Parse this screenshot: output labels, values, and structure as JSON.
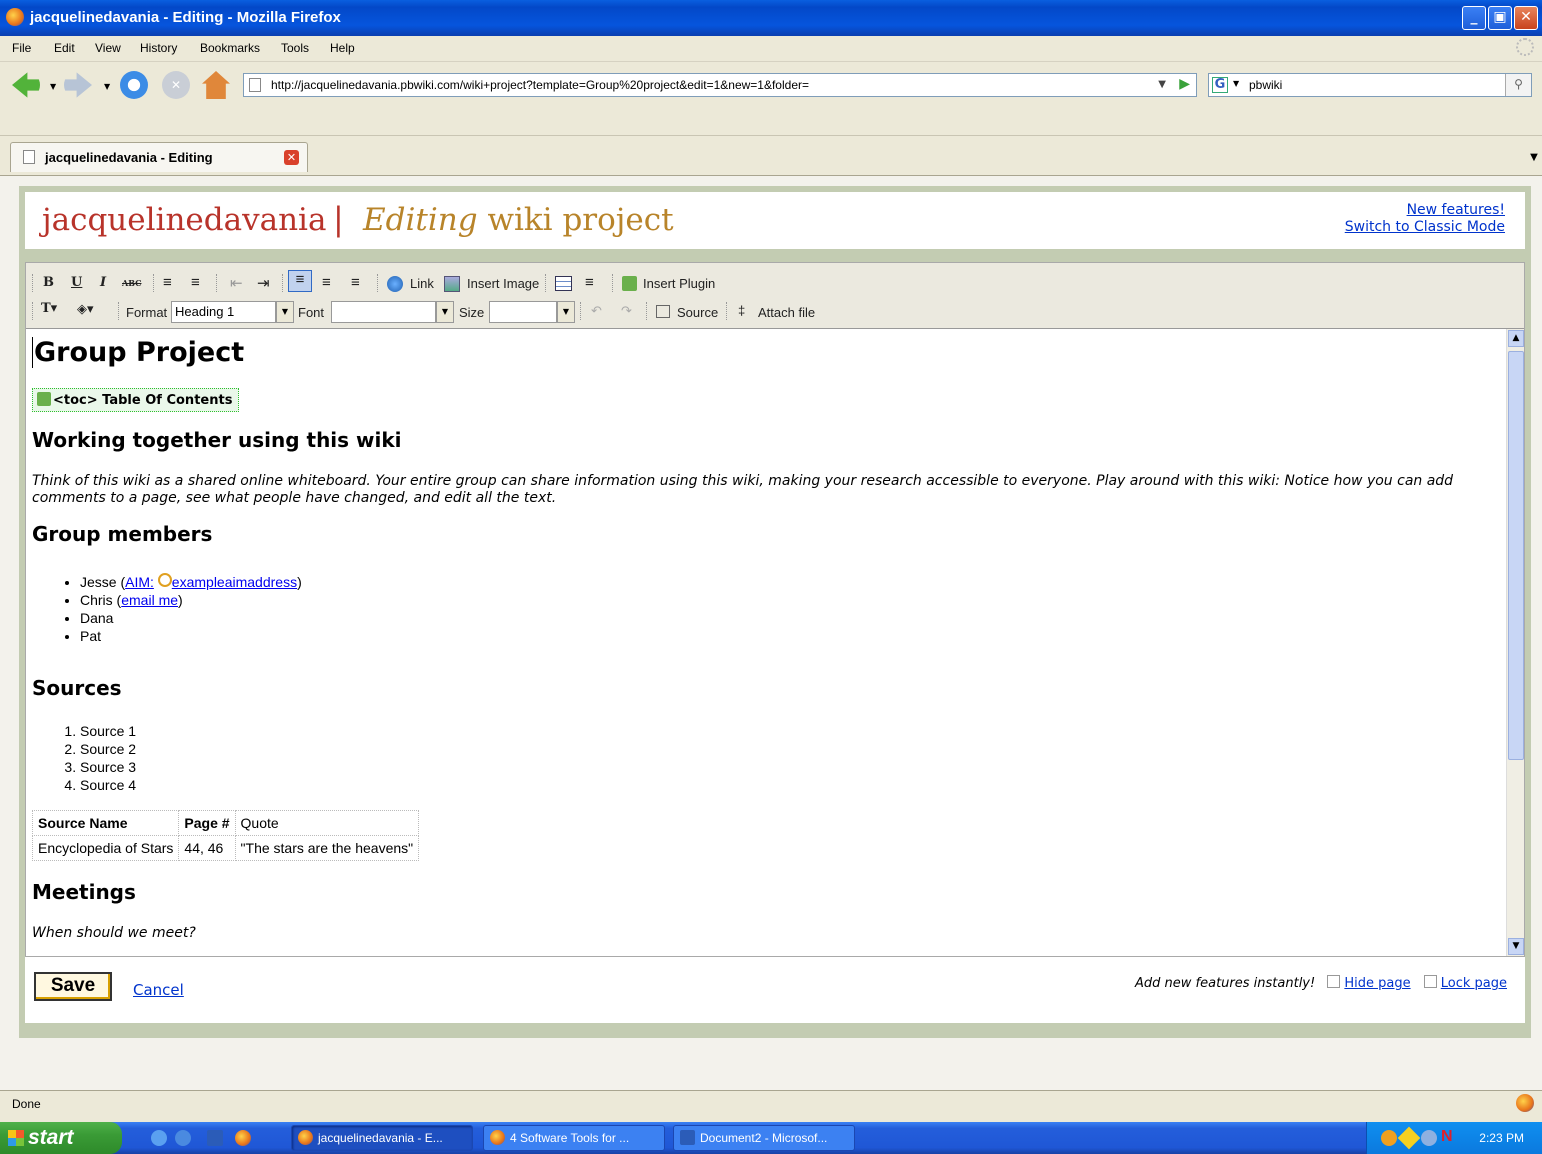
{
  "window": {
    "title": "jacquelinedavania - Editing - Mozilla Firefox"
  },
  "menu": [
    "File",
    "Edit",
    "View",
    "History",
    "Bookmarks",
    "Tools",
    "Help"
  ],
  "nav": {
    "url": "http://jacquelinedavania.pbwiki.com/wiki+project?template=Group%20project&edit=1&new=1&folder=",
    "search": "pbwiki"
  },
  "tab": {
    "label": "jacquelinedavania - Editing"
  },
  "header": {
    "site": "jacquelinedavania",
    "separator": "|",
    "editing": "Editing",
    "page": "wiki project",
    "new_features": "New features!",
    "classic_mode": "Switch to Classic Mode"
  },
  "toolbar": {
    "bold": "B",
    "underline": "U",
    "italic": "I",
    "strike": "ABC",
    "link": "Link",
    "insert_image": "Insert Image",
    "insert_plugin": "Insert Plugin",
    "format_label": "Format",
    "format_value": "Heading 1",
    "font_label": "Font",
    "font_value": "",
    "size_label": "Size",
    "size_value": "",
    "source": "Source",
    "attach": "Attach file"
  },
  "doc": {
    "title": "Group Project",
    "toc": "<toc> Table Of Contents",
    "h_working": "Working together using this wiki",
    "intro": "Think of this wiki as a shared online whiteboard. Your entire group can share information using this wiki, making your research accessible to everyone. Play around with this wiki: Notice how you can add comments to a page, see what people have changed, and edit all the text.",
    "h_members": "Group members",
    "members": {
      "jesse": "Jesse (",
      "aim_label": "AIM:",
      "aim_address": "exampleaimaddress",
      "close": ")",
      "chris": "Chris (",
      "email": "email me",
      "dana": "Dana",
      "pat": "Pat"
    },
    "h_sources": "Sources",
    "sources": [
      "Source 1",
      "Source 2",
      "Source 3",
      "Source 4"
    ],
    "table": {
      "headers": [
        "Source Name",
        "Page #",
        "Quote"
      ],
      "rows": [
        [
          "Encyclopedia of Stars",
          "44, 46",
          "\"The stars are the heavens\""
        ]
      ]
    },
    "h_meetings": "Meetings",
    "meetings_q": "When should we meet?"
  },
  "footer": {
    "save": "Save",
    "cancel": "Cancel",
    "add_features": "Add new features instantly!",
    "hide_page": "Hide page",
    "lock_page": "Lock page"
  },
  "status": {
    "text": "Done"
  },
  "taskbar": {
    "start": "start",
    "tasks": [
      "jacquelinedavania - E...",
      "4 Software Tools for ...",
      "Document2 - Microsof..."
    ],
    "tray_letter": "N",
    "clock": "2:23 PM"
  }
}
